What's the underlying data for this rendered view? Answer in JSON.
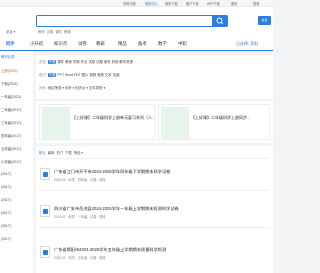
{
  "topbar": {
    "links": [
      "学段切换",
      "我的中心",
      "我的下载",
      "客户下载",
      "APP下载",
      "服务"
    ],
    "right": "登录"
  },
  "header": {
    "logo": "",
    "location": "北京 ▾",
    "search_tabs": [
      "教材",
      "试卷",
      "课件",
      "教案"
    ],
    "badge": "会员"
  },
  "nav": {
    "items": [
      "同步",
      "小升初",
      "知识点",
      "试卷",
      "教研",
      "精品",
      "备考",
      "数学",
      "中职"
    ],
    "active_index": 0,
    "right": "已选择: 资料"
  },
  "left_panel": {
    "items": [
      {
        "label": "教材目录",
        "style": "head"
      },
      {
        "label": "上册(2025)",
        "style": "red"
      },
      {
        "label": "下册(2024)",
        "style": ""
      },
      {
        "label": "一年级(2022)",
        "style": ""
      },
      {
        "label": "二年级(2017)",
        "style": ""
      },
      {
        "label": "三年级(2017)",
        "style": ""
      },
      {
        "label": "四年级(2017)",
        "style": ""
      },
      {
        "label": "五年级(2017)",
        "style": ""
      },
      {
        "label": "六年级(2017)",
        "style": ""
      },
      {
        "label": "(2017)",
        "style": ""
      },
      {
        "label": "(2017)",
        "style": ""
      },
      {
        "label": "(2017)",
        "style": ""
      },
      {
        "label": "(2017)",
        "style": ""
      },
      {
        "label": "(2017)",
        "style": ""
      },
      {
        "label": "(2017)",
        "style": ""
      }
    ]
  },
  "filters": {
    "row1": {
      "label": "类型:",
      "items": [
        "不限",
        "课件",
        "教案",
        "学案",
        "作业",
        "试卷",
        "试题",
        "素材",
        "其他",
        "教学资源"
      ]
    },
    "row2": {
      "label": "格式:",
      "items": [
        "不限",
        "PPT",
        "Word",
        "PDF",
        "图片",
        "视频",
        "音频",
        "文本",
        "压缩"
      ]
    },
    "row3": {
      "label": "其他:",
      "items": [
        "地区筛选",
        "年份",
        "知识点",
        "文件类型"
      ]
    }
  },
  "featured": [
    {
      "title": "【上好课】二年级科学上册单元复习系列（人..."
    },
    {
      "title": "【上好课】二年级科学上册同步..."
    }
  ],
  "list": {
    "sort": [
      "默认",
      "最新",
      "热门",
      "下载",
      "筛选"
    ],
    "items": [
      {
        "title": "广东省江门市开平市2024-2025学年四年级下学期期末科学试卷",
        "meta": "2025-06 · 科学 · 四年级 · 试卷 · 期末"
      },
      {
        "title": "四川省广安市岳池县2024-2025学年一年级上学期期末检测科学试卷",
        "meta": "2025-01 · 科学 · 一年级 · 试卷 · 期末"
      },
      {
        "title": "广东省揭阳市2024-2025学年五年级上学期期末质量科学检测",
        "meta": "2025-01 · 科学 · 五年级 · 试卷 · 期末"
      }
    ]
  }
}
